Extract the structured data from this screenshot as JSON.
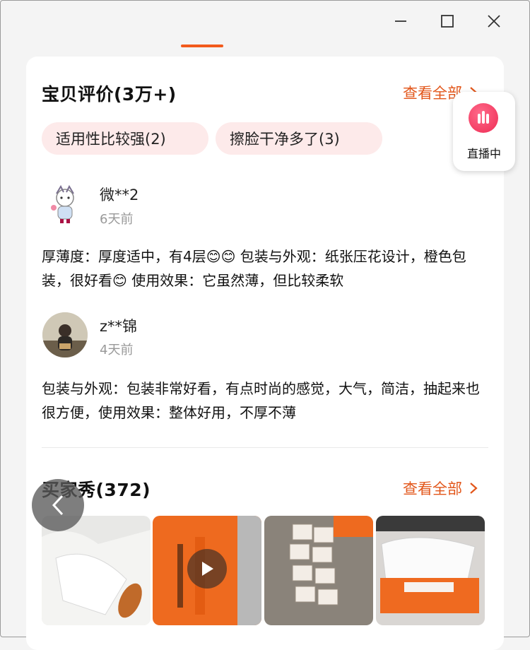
{
  "window": {
    "controls": [
      {
        "name": "minimize-button",
        "icon": "minimize-icon"
      },
      {
        "name": "maximize-button",
        "icon": "maximize-icon"
      },
      {
        "name": "close-button",
        "icon": "close-icon"
      }
    ]
  },
  "reviews": {
    "title": "宝贝评价(3万+)",
    "see_all": "查看全部",
    "tags": [
      "适用性比较强(2)",
      "擦脸干净多了(3)"
    ],
    "items": [
      {
        "user": "微**2",
        "time": "6天前",
        "text": "厚薄度：厚度适中，有4层😊😊 包装与外观：纸张压花设计，橙色包装，很好看😊 使用效果：它虽然薄，但比较柔软"
      },
      {
        "user": "z**锦",
        "time": "4天前",
        "text": "包装与外观：包装非常好看，有点时尚的感觉，大气，简洁，抽起来也很方便，使用效果：整体好用，不厚不薄"
      }
    ]
  },
  "live_badge": {
    "label": "直播中"
  },
  "buyer_show": {
    "title": "买家秀(372)",
    "see_all": "查看全部"
  },
  "colors": {
    "accent": "#e2561a",
    "tag_bg": "#fdeaea",
    "live": "#ee2c54"
  }
}
